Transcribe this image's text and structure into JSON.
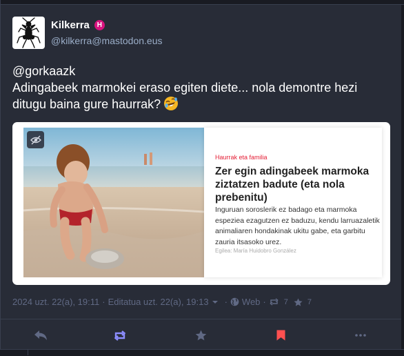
{
  "account": {
    "display_name": "Kilkerra",
    "role_badge": "H",
    "handle": "@kilkerra@mastodon.eus",
    "avatar_icon": "cricket-logo-icon"
  },
  "post": {
    "mention": "@gorkaazk",
    "text": "Adingabeek marmokei eraso egiten diete... nola demontre hezi ditugu baina gure haurrak?",
    "emoji_icon": "rolling-on-floor-laughing-emoji"
  },
  "preview": {
    "sensitive_icon": "eye-slash-icon",
    "article": {
      "category": "Haurrak eta familia",
      "title": "Zer egin adingabeek marmoka ziztatzen badute (eta nola prebenitu)",
      "excerpt": "Inguruan soroslerik ez badago eta marmoka espeziea ezagutzen ez baduzu, kendu larruazaletik animaliaren hondakinak ukitu gabe, eta garbitu zauria itsasoko urez.",
      "author": "Egilea: María Huidobro González"
    }
  },
  "meta": {
    "timestamp": "2024 uzt. 22(a), 19:11",
    "separator": "·",
    "edited": "Editatua uzt. 22(a), 19:13",
    "visibility": "Web",
    "boosts": "7",
    "favourites": "7"
  },
  "actions": {
    "reply_icon": "reply-icon",
    "boost_icon": "boost-icon",
    "favourite_icon": "star-icon",
    "bookmark_icon": "bookmark-icon",
    "more_icon": "ellipsis-icon"
  },
  "colors": {
    "background": "#191b22",
    "card": "#282c37",
    "muted_text": "#606984",
    "handle_text": "#9baec8",
    "boost_active": "#8c8dff",
    "bookmark_active": "#ff5050",
    "role_badge": "#d8137f"
  }
}
